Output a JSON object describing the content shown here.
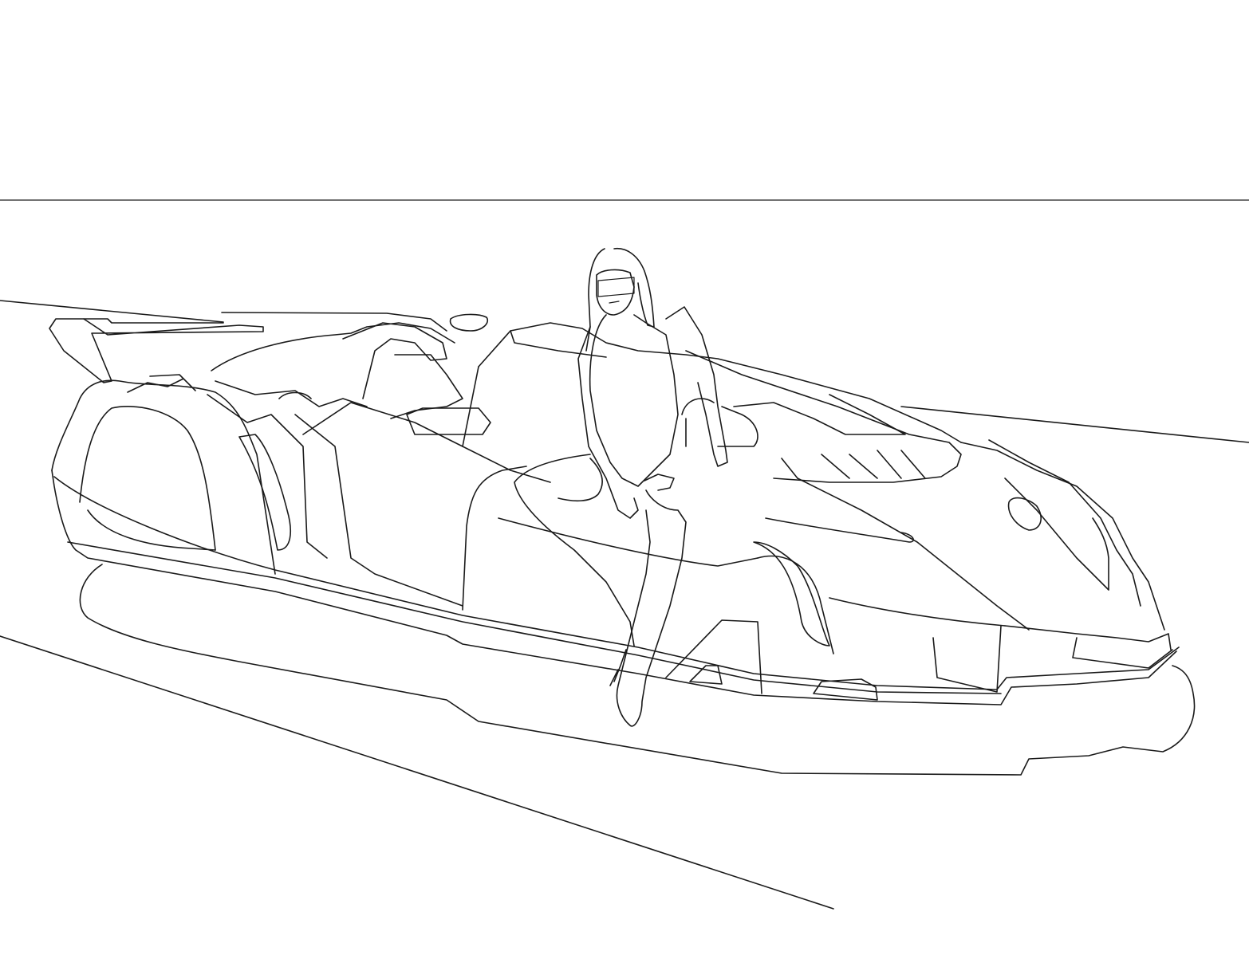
{
  "drawing": {
    "style": "black line art on white",
    "colors": {
      "background": "#ffffff",
      "stroke": "#1a1a1a",
      "horizon": "#444444"
    }
  }
}
